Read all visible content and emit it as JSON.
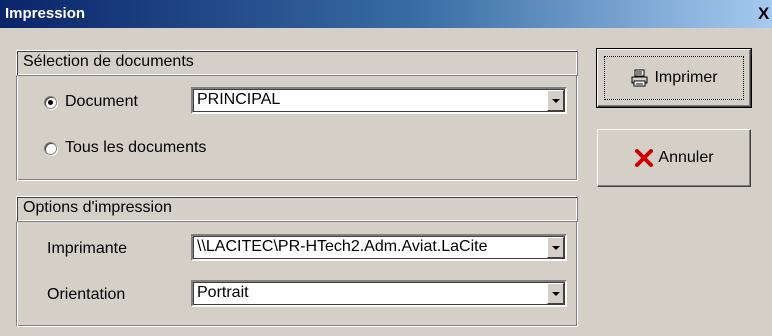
{
  "window": {
    "title": "Impression",
    "close_glyph": "X"
  },
  "documents_group": {
    "header": "Sélection de documents",
    "radio_document": {
      "label": "Document",
      "checked": true
    },
    "document_select": {
      "value": "PRINCIPAL"
    },
    "radio_all": {
      "label": "Tous les documents",
      "checked": false
    }
  },
  "print_options_group": {
    "header": "Options d'impression",
    "printer_label": "Imprimante",
    "printer_value": "\\\\LACITEC\\PR-HTech2.Adm.Aviat.LaCite",
    "orientation_label": "Orientation",
    "orientation_value": "Portrait"
  },
  "buttons": {
    "print": {
      "label": "Imprimer",
      "icon": "printer-icon"
    },
    "cancel": {
      "label": "Annuler",
      "icon": "red-x-icon"
    }
  },
  "colors": {
    "title_active": "#0a246a",
    "face": "#d4d0c8",
    "cancel_x": "#cc0000"
  }
}
